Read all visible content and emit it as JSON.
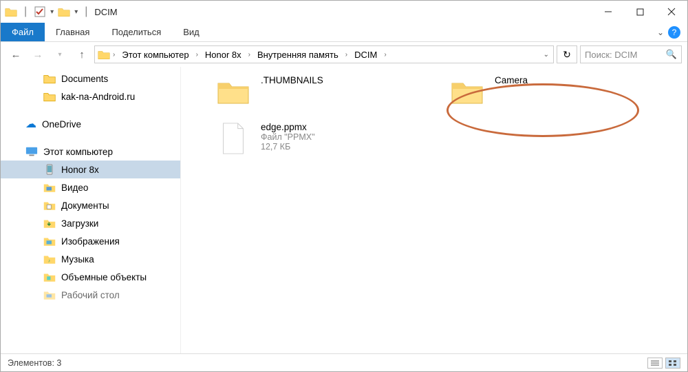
{
  "title": "DCIM",
  "ribbon": {
    "file": "Файл",
    "home": "Главная",
    "share": "Поделиться",
    "view": "Вид"
  },
  "breadcrumb": {
    "segments": [
      "Этот компьютер",
      "Honor 8x",
      "Внутренняя память",
      "DCIM"
    ]
  },
  "search": {
    "placeholder": "Поиск: DCIM"
  },
  "sidebar": {
    "items": [
      {
        "label": "Documents",
        "icon": "folder",
        "indent": 1
      },
      {
        "label": "kak-na-Android.ru",
        "icon": "folder",
        "indent": 1
      },
      {
        "label": "OneDrive",
        "icon": "onedrive",
        "indent": 0,
        "group": true
      },
      {
        "label": "Этот компьютер",
        "icon": "pc",
        "indent": 0,
        "group": true
      },
      {
        "label": "Honor 8x",
        "icon": "phone",
        "indent": 1,
        "selected": true
      },
      {
        "label": "Видео",
        "icon": "video",
        "indent": 1
      },
      {
        "label": "Документы",
        "icon": "docs",
        "indent": 1
      },
      {
        "label": "Загрузки",
        "icon": "downloads",
        "indent": 1
      },
      {
        "label": "Изображения",
        "icon": "pictures",
        "indent": 1
      },
      {
        "label": "Музыка",
        "icon": "music",
        "indent": 1
      },
      {
        "label": "Объемные объекты",
        "icon": "3d",
        "indent": 1
      },
      {
        "label": "Рабочий стол",
        "icon": "desktop",
        "indent": 1
      }
    ]
  },
  "content": {
    "folder1": {
      "name": ".THUMBNAILS"
    },
    "folder2": {
      "name": "Camera"
    },
    "file1": {
      "name": "edge.ppmx",
      "type": "Файл \"PPMX\"",
      "size": "12,7 КБ"
    }
  },
  "status": {
    "count_label": "Элементов: 3"
  }
}
